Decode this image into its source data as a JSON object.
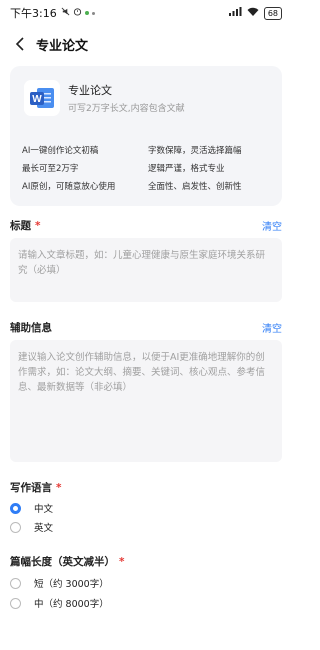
{
  "status_bar": {
    "time": "下午3:16",
    "icons": [
      "mute-icon",
      "alarm-icon"
    ],
    "signal": "signal-icon",
    "wifi": "wifi-icon",
    "battery": "68"
  },
  "nav": {
    "title": "专业论文"
  },
  "card": {
    "title": "专业论文",
    "subtitle": "可写2万字长文,内容包含文献",
    "features": [
      "AI一键创作论文初稿",
      "字数保障，灵活选择篇幅",
      "最长可至2万字",
      "逻辑严谨，格式专业",
      "AI原创，可随意放心使用",
      "全面性、启发性、创新性"
    ]
  },
  "title_section": {
    "label": "标题",
    "required_mark": "*",
    "clear": "清空",
    "placeholder": "请输入文章标题，如：儿童心理健康与原生家庭环境关系研究（必填）"
  },
  "aux_section": {
    "label": "辅助信息",
    "clear": "清空",
    "placeholder": "建议输入论文创作辅助信息，以便于AI更准确地理解你的创作需求，如：论文大纲、摘要、关键词、核心观点、参考信息、最新数据等（非必填）"
  },
  "language_section": {
    "label": "写作语言",
    "required_mark": "*",
    "options": [
      "中文",
      "英文"
    ],
    "selected": "中文"
  },
  "length_section": {
    "label": "篇幅长度（英文减半）",
    "required_mark": "*",
    "options": [
      "短（约 3000字）",
      "中（约 8000字）"
    ]
  },
  "colors": {
    "accent": "#2f7df6",
    "required": "#e53935",
    "word_blue": "#2b5fc4"
  }
}
